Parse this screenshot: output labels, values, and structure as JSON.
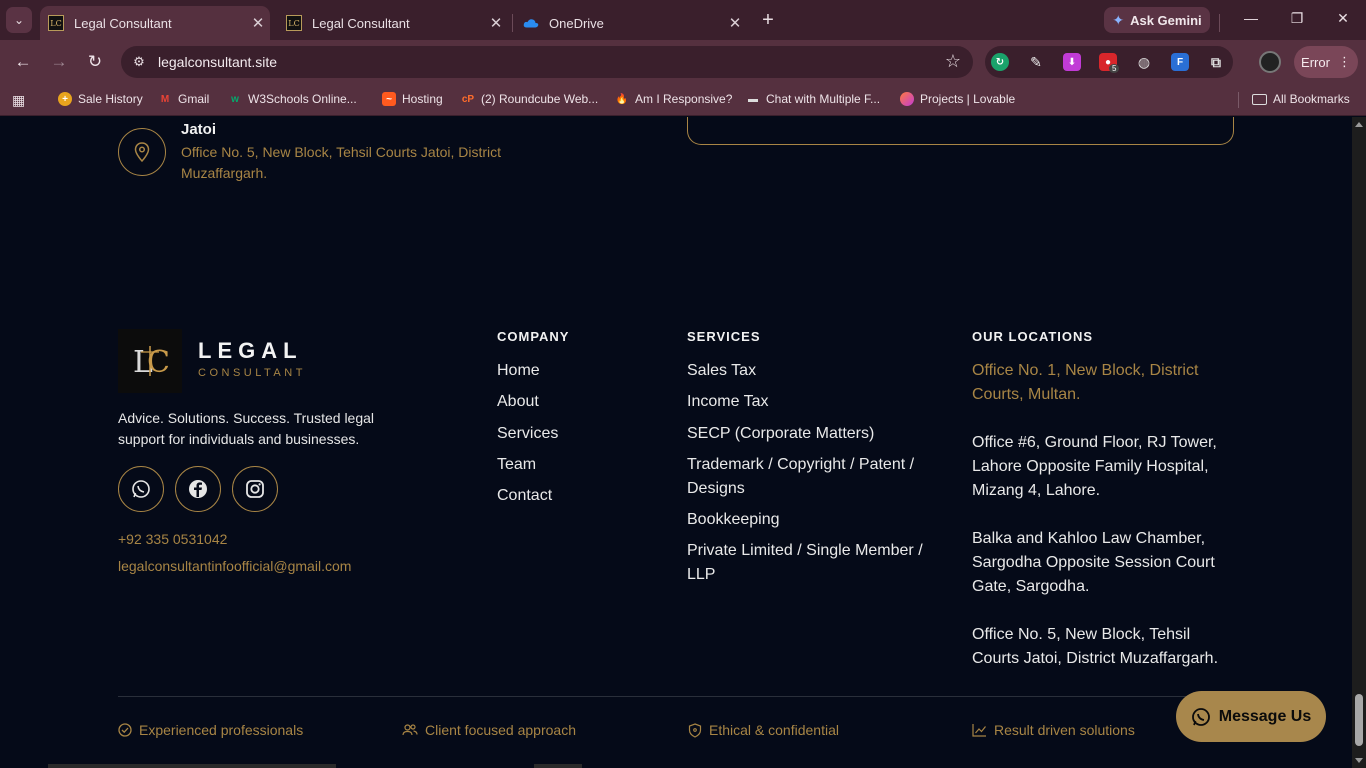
{
  "browser": {
    "tabs": [
      {
        "title": "Legal Consultant",
        "active": true
      },
      {
        "title": "Legal Consultant",
        "active": false
      },
      {
        "title": "OneDrive",
        "active": false
      }
    ],
    "gemini_label": "Ask Gemini",
    "url": "legalconsultant.site",
    "error_label": "Error",
    "extension_badge": "5",
    "bookmarks": [
      {
        "label": "Sale History"
      },
      {
        "label": "Gmail"
      },
      {
        "label": "W3Schools Online..."
      },
      {
        "label": "Hosting"
      },
      {
        "label": "(2) Roundcube Web..."
      },
      {
        "label": "Am I Responsive?"
      },
      {
        "label": "Chat with Multiple F..."
      },
      {
        "label": "Projects | Lovable"
      }
    ],
    "all_bookmarks": "All Bookmarks"
  },
  "page": {
    "jatoi": {
      "title": "Jatoi",
      "address": "Office No. 5, New Block, Tehsil Courts Jatoi, District Muzaffargarh."
    },
    "brand": {
      "name": "LEGAL",
      "sub": "CONSULTANT",
      "tagline": "Advice. Solutions. Success. Trusted legal support for individuals and businesses.",
      "phone": "+92 335 0531042",
      "email": "legalconsultantinfoofficial@gmail.com"
    },
    "company": {
      "heading": "COMPANY",
      "links": [
        "Home",
        "About",
        "Services",
        "Team",
        "Contact"
      ]
    },
    "services": {
      "heading": "SERVICES",
      "links": [
        "Sales Tax",
        "Income Tax",
        "SECP (Corporate Matters)",
        "Trademark / Copyright / Patent / Designs",
        "Bookkeeping",
        "Private Limited / Single Member / LLP"
      ]
    },
    "locations": {
      "heading": "OUR LOCATIONS",
      "items": [
        "Office No. 1, New Block, District Courts, Multan.",
        "Office #6, Ground Floor, RJ Tower, Lahore Opposite Family Hospital, Mizang 4, Lahore.",
        "Balka and Kahloo Law Chamber, Sargodha Opposite Session Court Gate, Sargodha.",
        "Office No. 5, New Block, Tehsil Courts Jatoi, District Muzaffargarh."
      ]
    },
    "features": [
      "Experienced professionals",
      "Client focused approach",
      "Ethical & confidential",
      "Result driven solutions"
    ],
    "message_button": "Message Us"
  },
  "colors": {
    "gold": "#a88545",
    "page_bg": "#050a18",
    "chrome": "#55303f"
  }
}
